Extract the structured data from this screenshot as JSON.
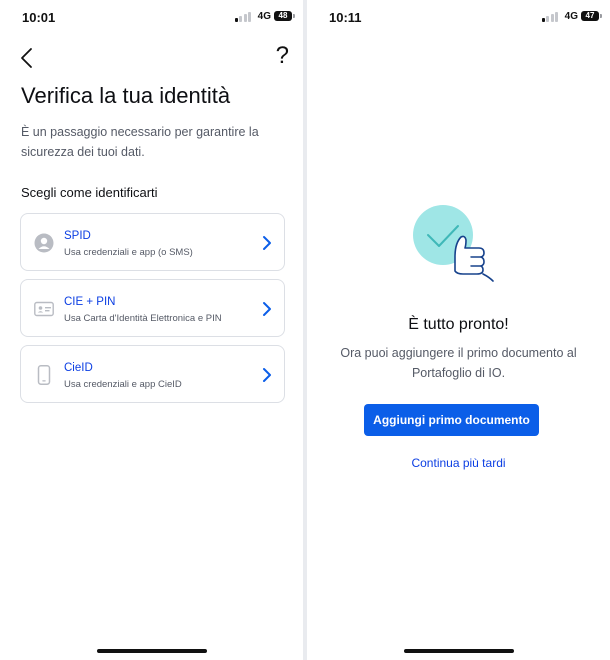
{
  "left_screen": {
    "status": {
      "time": "10:01",
      "network": "4G",
      "battery": "48"
    },
    "help_symbol": "?",
    "title": "Verifica la tua identità",
    "intro": "È un passaggio necessario per garantire la sicurezza dei tuoi dati.",
    "section_label": "Scegli come identificarti",
    "options": [
      {
        "name": "SPID",
        "description": "Usa credenziali e app (o SMS)",
        "icon": "user-avatar-icon"
      },
      {
        "name": "CIE + PIN",
        "description": "Usa Carta d'Identità Elettronica e PIN",
        "icon": "id-card-icon"
      },
      {
        "name": "CieID",
        "description": "Usa credenziali e app CieID",
        "icon": "smartphone-icon"
      }
    ]
  },
  "right_screen": {
    "status": {
      "time": "10:11",
      "network": "4G",
      "battery": "47"
    },
    "title": "È tutto pronto!",
    "description": "Ora puoi aggiungere il primo documento al Portafoglio di IO.",
    "primary_button": "Aggiungi primo documento",
    "secondary_link": "Continua più tardi"
  },
  "colors": {
    "accent_blue": "#0b5ee8",
    "link_blue": "#0b3ee3",
    "illustration_teal": "#9fe6e6",
    "illustration_outline": "#17428c"
  }
}
